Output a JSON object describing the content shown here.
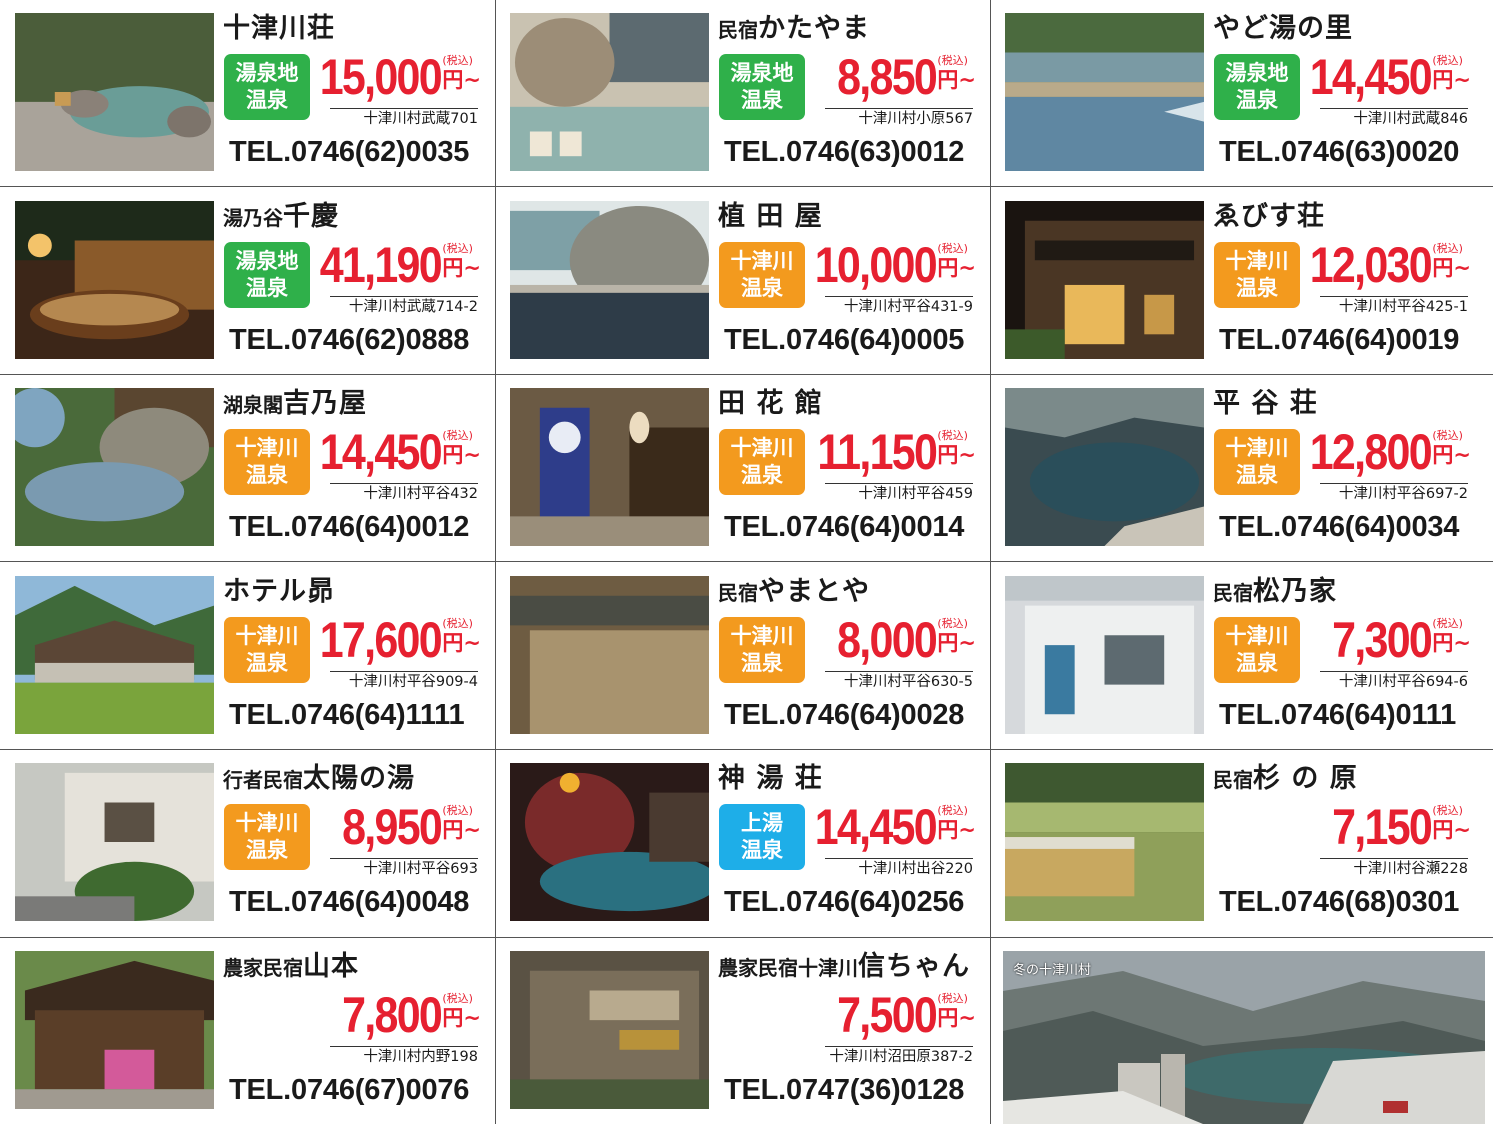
{
  "cards": [
    {
      "name": "十津川荘",
      "prefix": "",
      "badge": "湯泉地\n温泉",
      "badge_color": "green",
      "price": "15,000",
      "tax": "(税込)",
      "yen": "円~",
      "address": "十津川村武蔵701",
      "tel": "TEL.0746(62)0035",
      "photo": "rock-bath"
    },
    {
      "name": "かたやま",
      "prefix": "民宿",
      "badge": "湯泉地\n温泉",
      "badge_color": "green",
      "price": "8,850",
      "tax": "(税込)",
      "yen": "円~",
      "address": "十津川村小原567",
      "tel": "TEL.0746(63)0012",
      "photo": "indoor-bath"
    },
    {
      "name": "やど湯の里",
      "prefix": "",
      "badge": "湯泉地\n温泉",
      "badge_color": "green",
      "price": "14,450",
      "tax": "(税込)",
      "yen": "円~",
      "address": "十津川村武蔵846",
      "tel": "TEL.0746(63)0020",
      "photo": "river-bath"
    },
    {
      "name": "千慶",
      "prefix": "湯乃谷",
      "badge": "湯泉地\n温泉",
      "badge_color": "green",
      "price": "41,190",
      "tax": "(税込)",
      "yen": "円~",
      "address": "十津川村武蔵714-2",
      "tel": "TEL.0746(62)0888",
      "photo": "barrel-bath"
    },
    {
      "name": "植 田 屋",
      "prefix": "",
      "badge": "十津川\n温泉",
      "badge_color": "orange",
      "price": "10,000",
      "tax": "(税込)",
      "yen": "円~",
      "address": "十津川村平谷431-9",
      "tel": "TEL.0746(64)0005",
      "photo": "stone-bath"
    },
    {
      "name": "ゑびす荘",
      "prefix": "",
      "badge": "十津川\n温泉",
      "badge_color": "orange",
      "price": "12,030",
      "tax": "(税込)",
      "yen": "円~",
      "address": "十津川村平谷425-1",
      "tel": "TEL.0746(64)0019",
      "photo": "inn-night"
    },
    {
      "name": "吉乃屋",
      "prefix": "湖泉閣",
      "badge": "十津川\n温泉",
      "badge_color": "orange",
      "price": "14,450",
      "tax": "(税込)",
      "yen": "円~",
      "address": "十津川村平谷432",
      "tel": "TEL.0746(64)0012",
      "photo": "garden-bath"
    },
    {
      "name": "田 花 館",
      "prefix": "",
      "badge": "十津川\n温泉",
      "badge_color": "orange",
      "price": "11,150",
      "tax": "(税込)",
      "yen": "円~",
      "address": "十津川村平谷459",
      "tel": "TEL.0746(64)0014",
      "photo": "entrance"
    },
    {
      "name": "平 谷 荘",
      "prefix": "",
      "badge": "十津川\n温泉",
      "badge_color": "orange",
      "price": "12,800",
      "tax": "(税込)",
      "yen": "円~",
      "address": "十津川村平谷697-2",
      "tel": "TEL.0746(64)0034",
      "photo": "cave-bath"
    },
    {
      "name": "ホテル昴",
      "prefix": "",
      "badge": "十津川\n温泉",
      "badge_color": "orange",
      "price": "17,600",
      "tax": "(税込)",
      "yen": "円~",
      "address": "十津川村平谷909-4",
      "tel": "TEL.0746(64)1111",
      "photo": "hotel"
    },
    {
      "name": "やまとや",
      "prefix": "民宿",
      "badge": "十津川\n温泉",
      "badge_color": "orange",
      "price": "8,000",
      "tax": "(税込)",
      "yen": "円~",
      "address": "十津川村平谷630-5",
      "tel": "TEL.0746(64)0028",
      "photo": "wood-bath"
    },
    {
      "name": "松乃家",
      "prefix": "民宿",
      "badge": "十津川\n温泉",
      "badge_color": "orange",
      "price": "7,300",
      "tax": "(税込)",
      "yen": "円~",
      "address": "十津川村平谷694-6",
      "tel": "TEL.0746(64)0111",
      "photo": "white-house"
    },
    {
      "name": "太陽の湯",
      "prefix": "行者民宿",
      "badge": "十津川\n温泉",
      "badge_color": "orange",
      "price": "8,950",
      "tax": "(税込)",
      "yen": "円~",
      "address": "十津川村平谷693",
      "tel": "TEL.0746(64)0048",
      "photo": "street-house"
    },
    {
      "name": "神 湯 荘",
      "prefix": "",
      "badge": "上湯\n温泉",
      "badge_color": "blue",
      "price": "14,450",
      "tax": "(税込)",
      "yen": "円~",
      "address": "十津川村出谷220",
      "tel": "TEL.0746(64)0256",
      "photo": "night-bath"
    },
    {
      "name": "杉 の 原",
      "prefix": "民宿",
      "badge": "",
      "badge_color": "",
      "price": "7,150",
      "tax": "(税込)",
      "yen": "円~",
      "address": "十津川村谷瀬228",
      "tel": "TEL.0746(68)0301",
      "photo": "rice-field"
    },
    {
      "name": "山本",
      "prefix": "農家民宿",
      "badge": "",
      "badge_color": "",
      "price": "7,800",
      "tax": "(税込)",
      "yen": "円~",
      "address": "十津川村内野198",
      "tel": "TEL.0746(67)0076",
      "photo": "farmhouse"
    },
    {
      "name": "信ちゃん",
      "prefix": "農家民宿十津川",
      "badge": "",
      "badge_color": "",
      "price": "7,500",
      "tax": "(税込)",
      "yen": "円~",
      "address": "十津川村沼田原387-2",
      "tel": "TEL.0747(36)0128",
      "photo": "wood-sign"
    }
  ],
  "winter_caption": "冬の十津川村",
  "colors": {
    "badge_green": "#2fb04a",
    "badge_orange": "#f39a1e",
    "badge_blue": "#1eaee8",
    "price_red": "#e62030"
  }
}
